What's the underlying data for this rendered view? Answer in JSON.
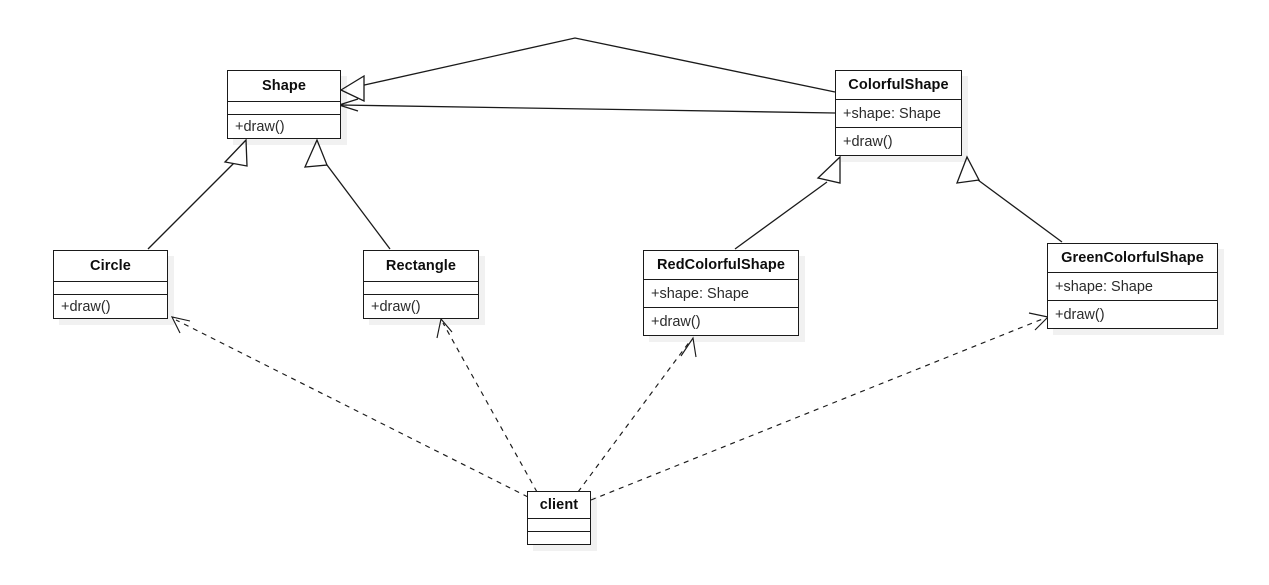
{
  "diagram": {
    "title": "Decorator pattern UML class diagram",
    "type": "uml-class-diagram",
    "background_color": "#ffffff",
    "line_color": "#1a1a1a"
  },
  "classes": {
    "shape": {
      "name": "Shape",
      "attributes_label": "",
      "operations": "+draw()"
    },
    "colorful_shape": {
      "name": "ColorfulShape",
      "attribute": "+shape: Shape",
      "operations": "+draw()"
    },
    "circle": {
      "name": "Circle",
      "attributes_label": "",
      "operations": "+draw()"
    },
    "rectangle": {
      "name": "Rectangle",
      "attributes_label": "",
      "operations": "+draw()"
    },
    "red_colorful_shape": {
      "name": "RedColorfulShape",
      "attribute": "+shape: Shape",
      "operations": "+draw()"
    },
    "green_colorful_shape": {
      "name": "GreenColorfulShape",
      "attribute": "+shape: Shape",
      "operations": "+draw()"
    },
    "client": {
      "name": "client",
      "attributes_label": "",
      "operations_label": ""
    }
  },
  "relationships": [
    {
      "id": "gen-colorful-shape",
      "kind": "generalization",
      "from": "ColorfulShape",
      "to": "Shape"
    },
    {
      "id": "assoc-colorful-shape",
      "kind": "association",
      "from": "ColorfulShape",
      "to": "Shape"
    },
    {
      "id": "gen-circle-shape",
      "kind": "generalization",
      "from": "Circle",
      "to": "Shape"
    },
    {
      "id": "gen-rectangle-shape",
      "kind": "generalization",
      "from": "Rectangle",
      "to": "Shape"
    },
    {
      "id": "gen-red-colorful",
      "kind": "generalization",
      "from": "RedColorfulShape",
      "to": "ColorfulShape"
    },
    {
      "id": "gen-green-colorful",
      "kind": "generalization",
      "from": "GreenColorfulShape",
      "to": "ColorfulShape"
    },
    {
      "id": "dep-client-circle",
      "kind": "dependency",
      "from": "client",
      "to": "Circle"
    },
    {
      "id": "dep-client-rectangle",
      "kind": "dependency",
      "from": "client",
      "to": "Rectangle"
    },
    {
      "id": "dep-client-red",
      "kind": "dependency",
      "from": "client",
      "to": "RedColorfulShape"
    },
    {
      "id": "dep-client-green",
      "kind": "dependency",
      "from": "client",
      "to": "GreenColorfulShape"
    }
  ]
}
